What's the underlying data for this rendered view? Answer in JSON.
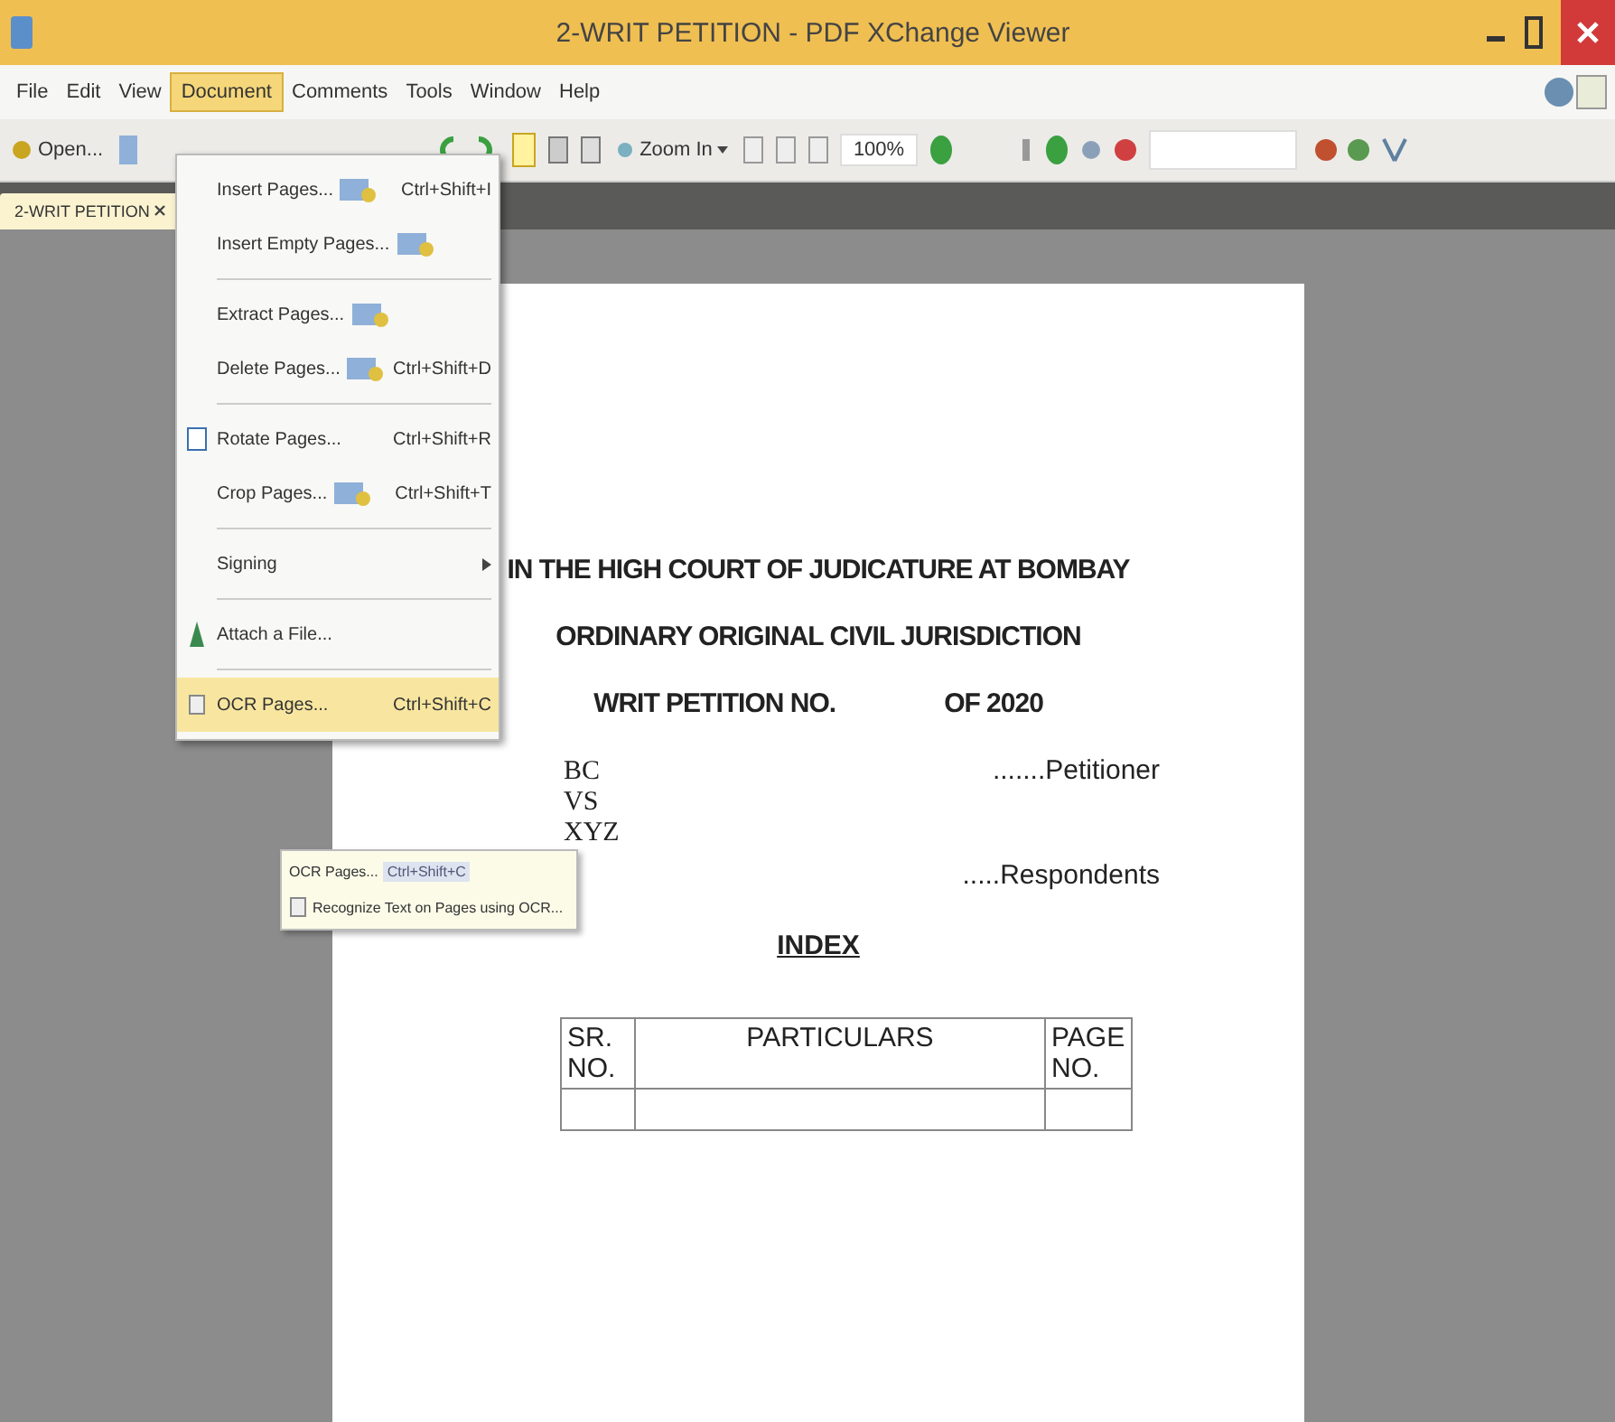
{
  "window": {
    "title": "2-WRIT PETITION - PDF XChange Viewer"
  },
  "menu_bar": [
    {
      "label": "File",
      "selected": false
    },
    {
      "label": "Edit",
      "selected": false
    },
    {
      "label": "View",
      "selected": false
    },
    {
      "label": "Document",
      "selected": true
    },
    {
      "label": "Comments",
      "selected": false
    },
    {
      "label": "Tools",
      "selected": false
    },
    {
      "label": "Window",
      "selected": false
    },
    {
      "label": "Help",
      "selected": false
    }
  ],
  "toolbar": {
    "open": "Open...",
    "zoom_in": "Zoom In",
    "zoom_value": "100%"
  },
  "tabs": [
    {
      "label": "2-WRIT PETITION",
      "selected": true
    }
  ],
  "document_menu": [
    {
      "label": "Insert Pages...",
      "shortcut": "Ctrl+Shift+I",
      "separator_before": false,
      "submenu": false,
      "selected": false
    },
    {
      "label": "Insert Empty Pages...",
      "separator_before": false,
      "submenu": false,
      "selected": false
    },
    {
      "label": "Extract Pages...",
      "separator_before": true,
      "submenu": false,
      "selected": false
    },
    {
      "label": "Delete Pages...",
      "shortcut": "Ctrl+Shift+D",
      "separator_before": false,
      "submenu": false,
      "selected": false
    },
    {
      "label": "Rotate Pages...",
      "shortcut": "Ctrl+Shift+R",
      "separator_before": true,
      "submenu": false,
      "selected": false
    },
    {
      "label": "Crop Pages...",
      "shortcut": "Ctrl+Shift+T",
      "separator_before": false,
      "submenu": false,
      "selected": false
    },
    {
      "label": "Signing",
      "separator_before": true,
      "submenu": true,
      "selected": false
    },
    {
      "label": "Attach a File...",
      "separator_before": true,
      "submenu": false,
      "selected": false
    },
    {
      "label": "OCR Pages...",
      "shortcut": "Ctrl+Shift+C",
      "separator_before": true,
      "submenu": false,
      "selected": true
    }
  ],
  "tooltip": {
    "title": "OCR Pages...",
    "shortcut": "Ctrl+Shift+C",
    "description": "Recognize Text on Pages using OCR..."
  },
  "document": {
    "heading_lines": [
      "IN THE HIGH COURT OF JUDICATURE AT BOMBAY",
      "ORDINARY ORIGINAL CIVIL JURISDICTION"
    ],
    "petition_label": "WRIT PETITION NO.",
    "petition_year": "OF 2020",
    "petitioner": "BC",
    "petitioner_role": ".......Petitioner",
    "versus": "VS",
    "respondent": "XYZ",
    "respondent_role": ".....Respondents",
    "index_title": "INDEX",
    "table": {
      "columns": [
        "SR. NO.",
        "PARTICULARS",
        "PAGE NO."
      ]
    }
  }
}
